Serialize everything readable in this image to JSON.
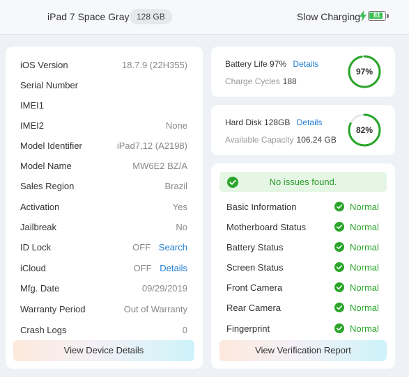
{
  "header": {
    "device_name": "iPad 7 Space Gray",
    "storage": "128 GB",
    "charging_label": "Slow Charging",
    "battery_level": "81"
  },
  "device_info": {
    "rows": [
      {
        "label": "iOS Version",
        "value": "18.7.9 (22H355)",
        "link": ""
      },
      {
        "label": "Serial Number",
        "value": "",
        "link": ""
      },
      {
        "label": "IMEI1",
        "value": "",
        "link": ""
      },
      {
        "label": "IMEI2",
        "value": "None",
        "link": ""
      },
      {
        "label": "Model Identifier",
        "value": "iPad7,12 (A2198)",
        "link": ""
      },
      {
        "label": "Model Name",
        "value": "MW6E2 BZ/A",
        "link": ""
      },
      {
        "label": "Sales Region",
        "value": "Brazil",
        "link": ""
      },
      {
        "label": "Activation",
        "value": "Yes",
        "link": ""
      },
      {
        "label": "Jailbreak",
        "value": "No",
        "link": ""
      },
      {
        "label": "ID Lock",
        "value": "OFF",
        "link": "Search"
      },
      {
        "label": "iCloud",
        "value": "OFF",
        "link": "Details"
      },
      {
        "label": "Mfg. Date",
        "value": "09/29/2019",
        "link": ""
      },
      {
        "label": "Warranty Period",
        "value": "Out of Warranty",
        "link": ""
      },
      {
        "label": "Crash Logs",
        "value": "0",
        "link": ""
      }
    ],
    "button_label": "View Device Details"
  },
  "battery": {
    "title": "Battery Life",
    "life": "97%",
    "details_link": "Details",
    "sub_label": "Charge Cycles",
    "cycles": "188",
    "ring_text": "97%",
    "ring_fraction": 0.97
  },
  "disk": {
    "title": "Hard Disk",
    "size": "128GB",
    "details_link": "Details",
    "sub_label": "Available Capacity",
    "available": "106.24 GB",
    "ring_text": "82%",
    "ring_fraction": 0.82
  },
  "verification": {
    "banner": "No issues found.",
    "rows": [
      {
        "label": "Basic Information",
        "status": "Normal"
      },
      {
        "label": "Motherboard Status",
        "status": "Normal"
      },
      {
        "label": "Battery Status",
        "status": "Normal"
      },
      {
        "label": "Screen Status",
        "status": "Normal"
      },
      {
        "label": "Front Camera",
        "status": "Normal"
      },
      {
        "label": "Rear Camera",
        "status": "Normal"
      },
      {
        "label": "Fingerprint",
        "status": "Normal"
      }
    ],
    "button_label": "View Verification Report"
  },
  "colors": {
    "accent_link": "#1f7cd3",
    "ok_green": "#2aa52a",
    "ring_green": "#2aa52a"
  }
}
